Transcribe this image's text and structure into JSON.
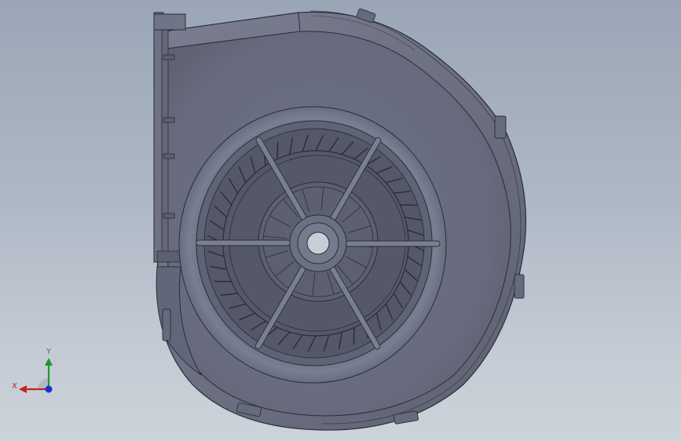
{
  "viewport": {
    "background_top": "#9aa6b6",
    "background_bottom": "#cdd3da"
  },
  "model": {
    "name": "blower-fan-housing",
    "body_color": "#6b6f80",
    "edge_color": "#2a2d36",
    "impeller_color": "#5c5f6f"
  },
  "triad": {
    "x_label": "X",
    "y_label": "Y",
    "x_color": "#c62020",
    "y_color": "#1a9a2a",
    "z_color": "#1b2fd6"
  }
}
